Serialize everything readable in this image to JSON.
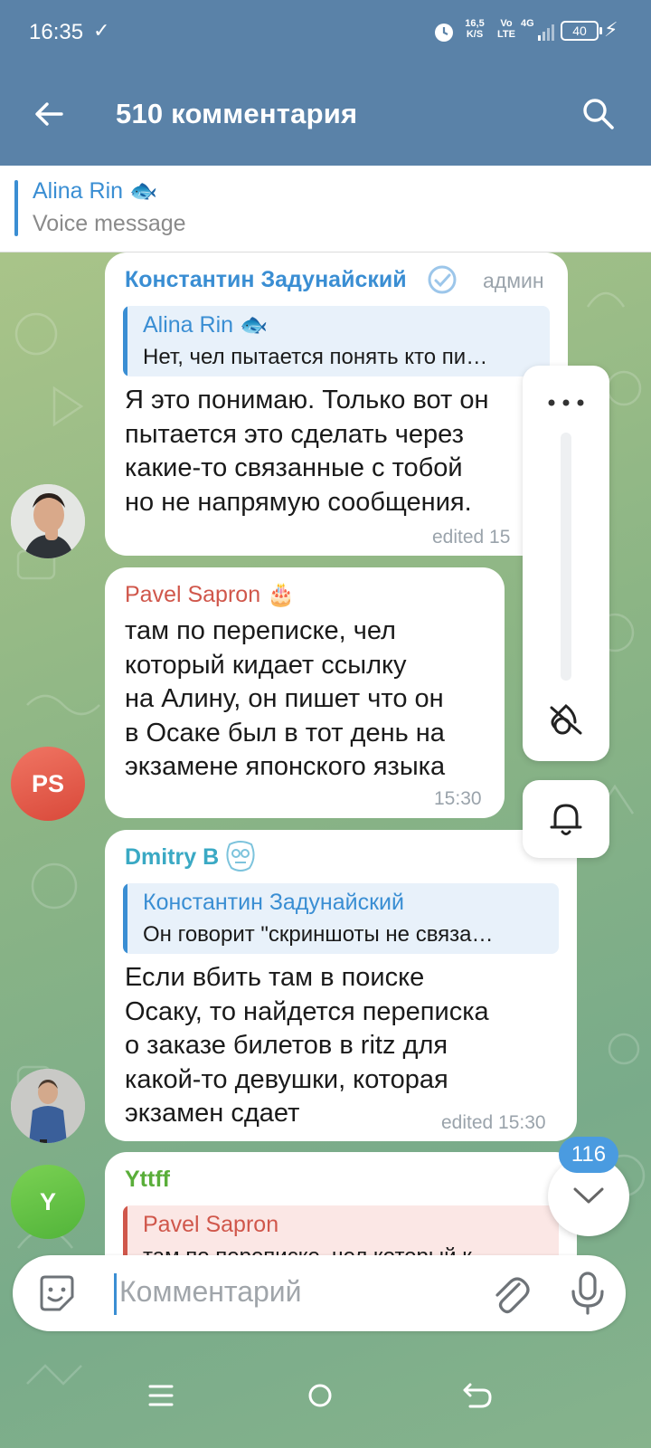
{
  "status_bar": {
    "time": "16:35",
    "speed": "16,5 K/S",
    "volte": "Vo LTE",
    "network": "4G",
    "battery": "40"
  },
  "header": {
    "title": "510 комментария"
  },
  "pinned": {
    "name": "Alina Rin 🐟",
    "text": "Voice message"
  },
  "messages": [
    {
      "sender": "Константин Задунайский",
      "sender_color": "#3a8ed3",
      "badge": "админ",
      "quote": {
        "name": "Alina Rin 🐟",
        "text": "Нет, чел пытается понять кто пи…"
      },
      "lines": [
        "Я это понимаю. Только вот он",
        "пытается это сделать через",
        "какие-то связанные с тобой",
        "но не напрямую сообщения."
      ],
      "meta": "edited 15"
    },
    {
      "sender": "Pavel Sapron 🎂",
      "sender_color": "#d0574b",
      "lines": [
        "там по переписке, чел",
        "который кидает ссылку",
        "на Алину, он пишет что он",
        "в Осаке был в тот день на",
        "экзамене японского языка"
      ],
      "meta": "15:30",
      "avatar": "PS"
    },
    {
      "sender": "Dmitry B",
      "sender_color": "#3aa9c4",
      "quote": {
        "name": "Константин Задунайский",
        "text": "Он говорит \"скриншоты не связа…"
      },
      "lines": [
        "Если вбить там в поиске",
        "Осаку, то найдется переписка",
        "о заказе билетов в ritz для",
        "какой-то девушки, которая",
        "экзамен сдает"
      ],
      "meta": "edited 15:30"
    },
    {
      "sender": "Yttff",
      "sender_color": "#5aae3a",
      "quote": {
        "name": "Pavel Sapron",
        "text": "там по переписке, чел который к…"
      },
      "avatar": "Y"
    }
  ],
  "scroll_badge": "116",
  "composer": {
    "placeholder": "Комментарий"
  },
  "colors": {
    "header": "#5a82a8",
    "accent": "#3a8ed3"
  }
}
